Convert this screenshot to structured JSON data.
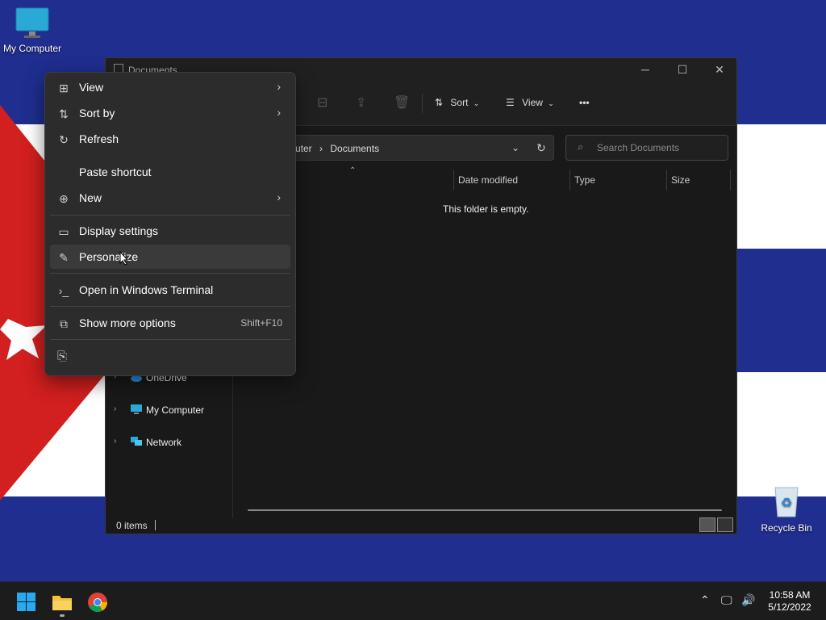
{
  "desktop": {
    "icons": [
      {
        "label": "My Computer"
      },
      {
        "label": "Recycle Bin"
      }
    ]
  },
  "explorer": {
    "title": "Documents",
    "toolbar": {
      "sort_label": "Sort",
      "view_label": "View",
      "more_label": "•••"
    },
    "address": {
      "crumbs": [
        "uter",
        "Documents"
      ]
    },
    "search": {
      "placeholder": "Search Documents"
    },
    "columns": [
      "Date modified",
      "Type",
      "Size"
    ],
    "empty_message": "This folder is empty.",
    "nav": [
      {
        "label": "OneDrive"
      },
      {
        "label": "My Computer"
      },
      {
        "label": "Network"
      }
    ],
    "status": {
      "count": "0 items"
    }
  },
  "context_menu": {
    "items": [
      {
        "label": "View",
        "icon": "grid-icon",
        "submenu": true
      },
      {
        "label": "Sort by",
        "icon": "sort-icon",
        "submenu": true
      },
      {
        "label": "Refresh",
        "icon": "refresh-icon"
      },
      {
        "label": "Paste shortcut"
      },
      {
        "label": "New",
        "icon": "plus-icon",
        "submenu": true
      },
      {
        "label": "Display settings",
        "icon": "display-icon"
      },
      {
        "label": "Personalize",
        "icon": "brush-icon",
        "hovered": true
      },
      {
        "label": "Open in Windows Terminal",
        "icon": "terminal-icon"
      },
      {
        "label": "Show more options",
        "icon": "share-icon",
        "shortcut": "Shift+F10"
      }
    ]
  },
  "taskbar": {
    "clock": {
      "time": "10:58 AM",
      "date": "5/12/2022"
    }
  },
  "colors": {
    "flag_blue": "#1f2e8f",
    "flag_red": "#d21f1f",
    "window_bg": "#191919",
    "menu_bg": "#2c2c2c",
    "taskbar_bg": "#1c1c1c"
  }
}
